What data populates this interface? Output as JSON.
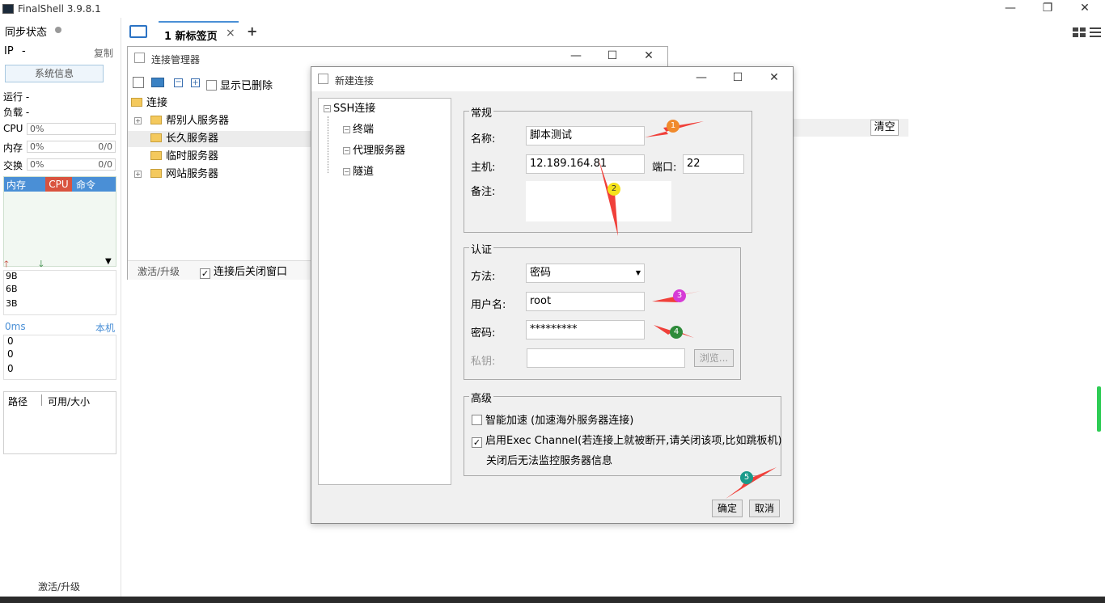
{
  "app": {
    "title": "FinalShell 3.9.8.1",
    "window_controls": [
      "—",
      "❐",
      "✕"
    ]
  },
  "tabs": [
    {
      "label": "1 新标签页",
      "close": "×"
    }
  ],
  "tab_add": "+",
  "sidebar": {
    "sync_status": "同步状态",
    "ip_label": "IP",
    "ip_value": "-",
    "copy": "复制",
    "sysinfo_button": "系统信息",
    "run_label": "运行 -",
    "load_label": "负载 -",
    "cpu_label": "CPU",
    "cpu_value": "0%",
    "mem_label": "内存",
    "mem_value": "0%",
    "mem_right": "0/0",
    "swap_label": "交换",
    "swap_value": "0%",
    "swap_right": "0/0",
    "proc_tabs": [
      "内存",
      "CPU",
      "命令"
    ],
    "net_values": [
      "9B",
      "6B",
      "3B"
    ],
    "ping_label": "0ms",
    "ping_right": "本机",
    "ping_values": [
      "0",
      "0",
      "0"
    ],
    "disk_headers": [
      "路径",
      "可用/大小"
    ],
    "activate": "激活/升级"
  },
  "conn_manager": {
    "title": "连接管理器",
    "show_deleted": "显示已删除",
    "tree": {
      "root": "连接",
      "items": [
        "帮别人服务器",
        "长久服务器",
        "临时服务器",
        "网站服务器"
      ]
    },
    "activate": "激活/升级",
    "close_after": "连接后关闭窗口"
  },
  "clear_button": "清空",
  "new_conn": {
    "title": "新建连接",
    "tree": {
      "root": "SSH连接",
      "children": [
        "终端",
        "代理服务器",
        "隧道"
      ]
    },
    "general": {
      "title": "常规",
      "name_label": "名称:",
      "name_value": "脚本测试",
      "host_label": "主机:",
      "host_value": "12.189.164.81",
      "port_label": "端口:",
      "port_value": "22",
      "note_label": "备注:",
      "note_value": ""
    },
    "auth": {
      "title": "认证",
      "method_label": "方法:",
      "method_value": "密码",
      "user_label": "用户名:",
      "user_value": "root",
      "password_label": "密码:",
      "password_value": "*********",
      "key_label": "私钥:",
      "key_value": "",
      "browse": "浏览..."
    },
    "advanced": {
      "title": "高级",
      "smart_accel": "智能加速 (加速海外服务器连接)",
      "smart_accel_checked": false,
      "exec_channel": "启用Exec Channel(若连接上就被断开,请关闭该项,比如跳板机)",
      "exec_channel_checked": true,
      "exec_note": "关闭后无法监控服务器信息"
    },
    "ok": "确定",
    "cancel": "取消"
  },
  "annotations": [
    {
      "label": "1",
      "color": "#f08a2c"
    },
    {
      "label": "2",
      "color": "#f5e21a"
    },
    {
      "label": "3",
      "color": "#d63bd6"
    },
    {
      "label": "4",
      "color": "#2e8b3a"
    },
    {
      "label": "5",
      "color": "#1a9a8a"
    }
  ],
  "colors": {
    "accent": "#4a8fd6",
    "arrow": "#f0403a",
    "proc_mem": "#4a8fd6",
    "proc_cpu": "#d9533f",
    "proc_cmd": "#4a8fd6"
  }
}
